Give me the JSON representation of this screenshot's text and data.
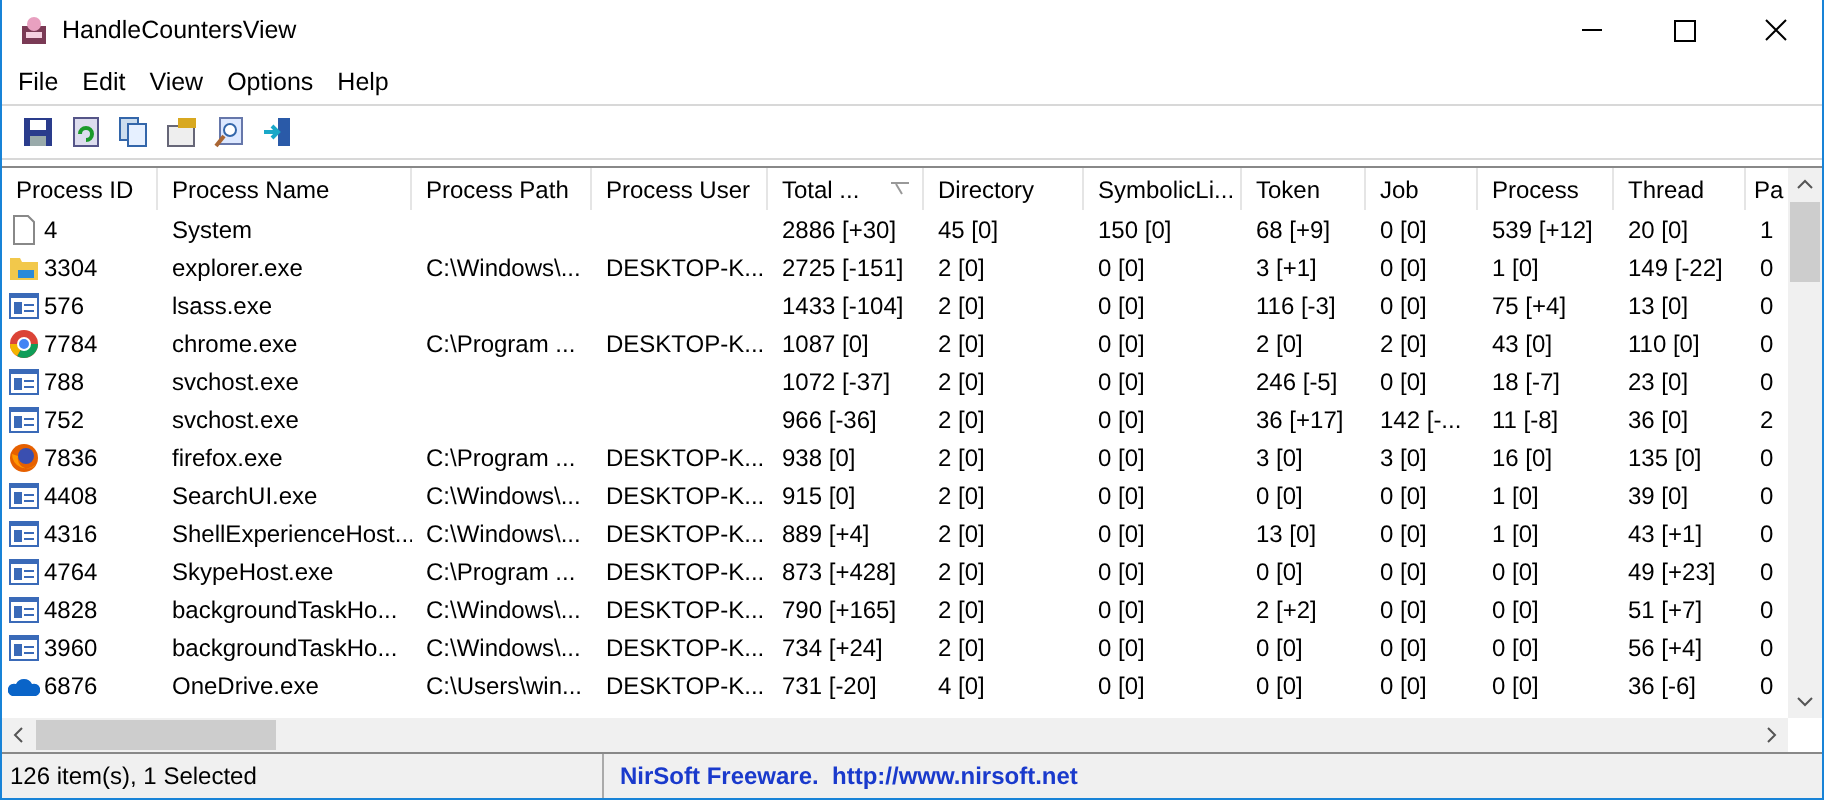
{
  "window": {
    "title": "HandleCountersView"
  },
  "menu": [
    "File",
    "Edit",
    "View",
    "Options",
    "Help"
  ],
  "toolbar": [
    {
      "kind": "save"
    },
    {
      "kind": "refresh"
    },
    {
      "kind": "copy"
    },
    {
      "kind": "properties"
    },
    {
      "kind": "find"
    },
    {
      "kind": "exit"
    }
  ],
  "table": {
    "columns": [
      {
        "label": "Process ID",
        "sorted": false
      },
      {
        "label": "Process Name",
        "sorted": false
      },
      {
        "label": "Process Path",
        "sorted": false
      },
      {
        "label": "Process User",
        "sorted": false
      },
      {
        "label": "Total ...",
        "sorted": true
      },
      {
        "label": "Directory",
        "sorted": false
      },
      {
        "label": "SymbolicLi...",
        "sorted": false
      },
      {
        "label": "Token",
        "sorted": false
      },
      {
        "label": "Job",
        "sorted": false
      },
      {
        "label": "Process",
        "sorted": false
      },
      {
        "label": "Thread",
        "sorted": false
      },
      {
        "label": "Pa",
        "sorted": false
      }
    ],
    "rows": [
      {
        "kind": "file",
        "cells": [
          "4",
          "System",
          "",
          "",
          "2886  [+30]",
          "45  [0]",
          "150  [0]",
          "68  [+9]",
          "0  [0]",
          "539  [+12]",
          "20  [0]",
          "1"
        ]
      },
      {
        "kind": "folder",
        "cells": [
          "3304",
          "explorer.exe",
          "C:\\Windows\\...",
          "DESKTOP-K...",
          "2725  [-151]",
          "2  [0]",
          "0  [0]",
          "3  [+1]",
          "0  [0]",
          "1  [0]",
          "149  [-22]",
          "0"
        ]
      },
      {
        "kind": "app",
        "cells": [
          "576",
          "lsass.exe",
          "",
          "",
          "1433  [-104]",
          "2  [0]",
          "0  [0]",
          "116  [-3]",
          "0  [0]",
          "75  [+4]",
          "13  [0]",
          "0"
        ]
      },
      {
        "kind": "chrome",
        "cells": [
          "7784",
          "chrome.exe",
          "C:\\Program ...",
          "DESKTOP-K...",
          "1087  [0]",
          "2  [0]",
          "0  [0]",
          "2  [0]",
          "2  [0]",
          "43  [0]",
          "110  [0]",
          "0"
        ]
      },
      {
        "kind": "app",
        "cells": [
          "788",
          "svchost.exe",
          "",
          "",
          "1072  [-37]",
          "2  [0]",
          "0  [0]",
          "246  [-5]",
          "0  [0]",
          "18  [-7]",
          "23  [0]",
          "0"
        ]
      },
      {
        "kind": "app",
        "cells": [
          "752",
          "svchost.exe",
          "",
          "",
          "966  [-36]",
          "2  [0]",
          "0  [0]",
          "36  [+17]",
          "142  [-...",
          "11  [-8]",
          "36  [0]",
          "2"
        ]
      },
      {
        "kind": "firefox",
        "cells": [
          "7836",
          "firefox.exe",
          "C:\\Program ...",
          "DESKTOP-K...",
          "938  [0]",
          "2  [0]",
          "0  [0]",
          "3  [0]",
          "3  [0]",
          "16  [0]",
          "135  [0]",
          "0"
        ]
      },
      {
        "kind": "app",
        "cells": [
          "4408",
          "SearchUI.exe",
          "C:\\Windows\\...",
          "DESKTOP-K...",
          "915  [0]",
          "2  [0]",
          "0  [0]",
          "0  [0]",
          "0  [0]",
          "1  [0]",
          "39  [0]",
          "0"
        ]
      },
      {
        "kind": "app",
        "cells": [
          "4316",
          "ShellExperienceHost...",
          "C:\\Windows\\...",
          "DESKTOP-K...",
          "889  [+4]",
          "2  [0]",
          "0  [0]",
          "13  [0]",
          "0  [0]",
          "1  [0]",
          "43  [+1]",
          "0"
        ]
      },
      {
        "kind": "app",
        "cells": [
          "4764",
          "SkypeHost.exe",
          "C:\\Program ...",
          "DESKTOP-K...",
          "873  [+428]",
          "2  [0]",
          "0  [0]",
          "0  [0]",
          "0  [0]",
          "0  [0]",
          "49  [+23]",
          "0"
        ]
      },
      {
        "kind": "app",
        "cells": [
          "4828",
          "backgroundTaskHo...",
          "C:\\Windows\\...",
          "DESKTOP-K...",
          "790  [+165]",
          "2  [0]",
          "0  [0]",
          "2  [+2]",
          "0  [0]",
          "0  [0]",
          "51  [+7]",
          "0"
        ]
      },
      {
        "kind": "app",
        "cells": [
          "3960",
          "backgroundTaskHo...",
          "C:\\Windows\\...",
          "DESKTOP-K...",
          "734  [+24]",
          "2  [0]",
          "0  [0]",
          "0  [0]",
          "0  [0]",
          "0  [0]",
          "56  [+4]",
          "0"
        ]
      },
      {
        "kind": "cloud",
        "cells": [
          "6876",
          "OneDrive.exe",
          "C:\\Users\\win...",
          "DESKTOP-K...",
          "731  [-20]",
          "4  [0]",
          "0  [0]",
          "0  [0]",
          "0  [0]",
          "0  [0]",
          "36  [-6]",
          "0"
        ]
      }
    ]
  },
  "status_bar": {
    "count": "126 item(s), 1 Selected",
    "credit": "NirSoft Freeware.  http://www.nirsoft.net"
  }
}
